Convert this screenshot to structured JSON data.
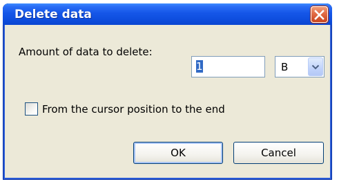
{
  "dialog": {
    "title": "Delete data",
    "close_icon": "close-icon",
    "amount_label": "Amount of data to delete:",
    "amount_value": "1",
    "unit_value": "B",
    "checkbox_label": "From the cursor position to the end",
    "checkbox_checked": false,
    "ok_label": "OK",
    "cancel_label": "Cancel"
  },
  "colors": {
    "titlebar": "#0a46d1",
    "client_bg": "#ece9d8",
    "close_button": "#c6401a",
    "selection": "#316ac5"
  }
}
